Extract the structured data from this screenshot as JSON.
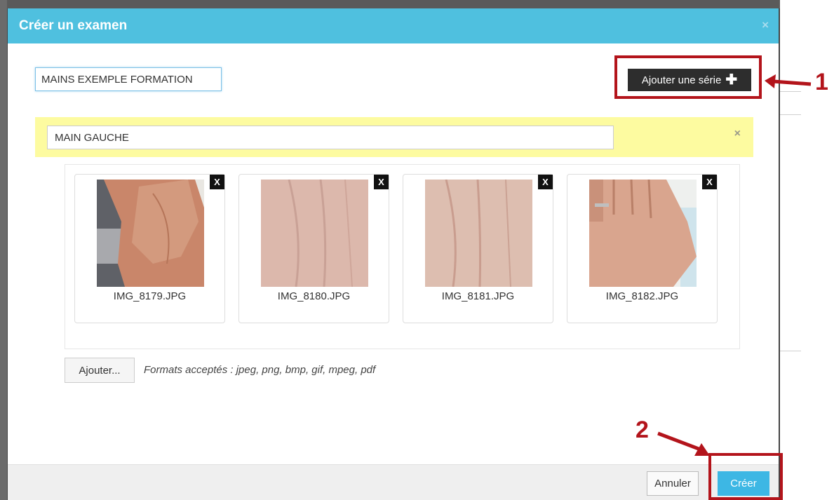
{
  "modal": {
    "title": "Créer un examen",
    "close_glyph": "×"
  },
  "exam": {
    "name_value": "MAINS EXEMPLE FORMATION"
  },
  "toolbar": {
    "add_series_label": "Ajouter une série",
    "add_series_icon": "plus-icon"
  },
  "series": {
    "name_value": "MAIN GAUCHE",
    "close_glyph": "×",
    "images": [
      {
        "filename": "IMG_8179.JPG",
        "remove_label": "X"
      },
      {
        "filename": "IMG_8180.JPG",
        "remove_label": "X"
      },
      {
        "filename": "IMG_8181.JPG",
        "remove_label": "X"
      },
      {
        "filename": "IMG_8182.JPG",
        "remove_label": "X"
      }
    ]
  },
  "upload": {
    "add_label": "Ajouter...",
    "formats_text": "Formats acceptés : jpeg, png, bmp, gif, mpeg, pdf"
  },
  "footer": {
    "cancel_label": "Annuler",
    "create_label": "Créer"
  },
  "annotations": {
    "callout_1": "1",
    "callout_2": "2"
  },
  "colors": {
    "header": "#4fc0df",
    "series_panel": "#fdfba0",
    "create_button": "#3db7e4",
    "callout": "#b3141b"
  }
}
